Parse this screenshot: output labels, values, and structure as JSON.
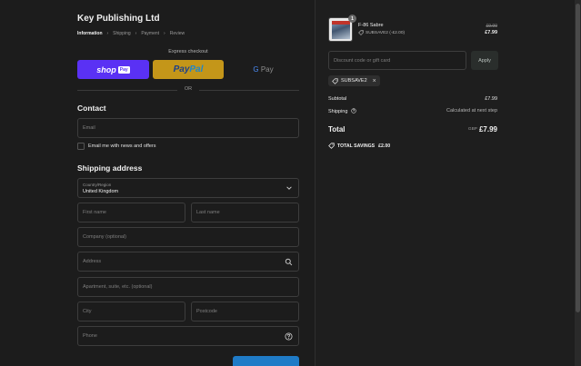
{
  "store": {
    "title": "Key Publishing Ltd"
  },
  "breadcrumb": {
    "items": [
      "Information",
      "Payment",
      "Review"
    ],
    "shipping": "Shipping"
  },
  "express": {
    "label": "Express checkout",
    "shop_text": "shop",
    "shop_badge": "Pay",
    "paypal_text_a": "Pay",
    "paypal_text_b": "Pal",
    "gpay_g": "G",
    "gpay_text": "Pay",
    "or": "OR"
  },
  "contact": {
    "heading": "Contact",
    "email_placeholder": "Email",
    "newsletter_label": "Email me with news and offers"
  },
  "shipping": {
    "heading": "Shipping address",
    "country_label": "Country/Region",
    "country_value": "United Kingdom",
    "first_name": "First name",
    "last_name": "Last name",
    "company": "Company (optional)",
    "address": "Address",
    "apartment": "Apartment, suite, etc. (optional)",
    "city": "City",
    "postcode": "Postcode",
    "phone": "Phone"
  },
  "cart": {
    "quantity": "1",
    "product_name": "F-86 Sabre",
    "product_discount": "SUBSAVE2 (-£2.00)",
    "price_old": "£9.99",
    "price_new": "£7.99"
  },
  "discount": {
    "placeholder": "Discount code or gift card",
    "apply_label": "Apply",
    "applied_code": "SUBSAVE2"
  },
  "summary": {
    "subtotal_label": "Subtotal",
    "subtotal_value": "£7.99",
    "shipping_label": "Shipping",
    "shipping_value": "Calculated at next step",
    "total_label": "Total",
    "currency": "GBP",
    "total_value": "£7.99",
    "savings_label": "TOTAL SAVINGS",
    "savings_value": "£2.00"
  },
  "colors": {
    "shop_pay": "#5a31f4",
    "paypal": "#c49619",
    "continue": "#1f7bc7"
  }
}
